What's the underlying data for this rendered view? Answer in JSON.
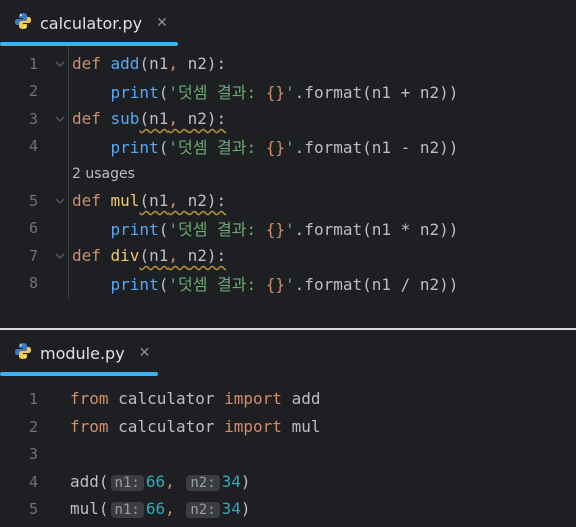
{
  "pane1": {
    "tab": {
      "title": "calculator.py",
      "close": "✕",
      "icon": "python-icon"
    },
    "lines": [
      {
        "num": "1",
        "tokens": [
          [
            "kw",
            "def "
          ],
          [
            "fn-def",
            "add"
          ],
          [
            "",
            "(n1"
          ],
          [
            "kw",
            ", "
          ],
          [
            "",
            "n2):"
          ]
        ]
      },
      {
        "num": "2",
        "tokens": [
          [
            "",
            "    "
          ],
          [
            "fn",
            "print"
          ],
          [
            "",
            "("
          ],
          [
            "str",
            "'덧셈 결과: "
          ],
          [
            "brace",
            "{}"
          ],
          [
            "str",
            "'"
          ],
          [
            "",
            ".format(n1 + n2))"
          ]
        ]
      },
      {
        "num": "3",
        "tokens": [
          [
            "kw",
            "def "
          ],
          [
            "fn-def",
            "sub"
          ],
          [
            "",
            "(n1"
          ],
          [
            "kw",
            ", "
          ],
          [
            "",
            "n2):"
          ]
        ]
      },
      {
        "num": "4",
        "tokens": [
          [
            "",
            "    "
          ],
          [
            "fn",
            "print"
          ],
          [
            "",
            "("
          ],
          [
            "str",
            "'덧셈 결과: "
          ],
          [
            "brace",
            "{}"
          ],
          [
            "str",
            "'"
          ],
          [
            "",
            ".format(n1 - n2))"
          ]
        ]
      },
      {
        "num": "5",
        "tokens": [
          [
            "kw",
            "def "
          ],
          [
            "fn-yellow",
            "mul"
          ],
          [
            "",
            "(n1"
          ],
          [
            "kw",
            ", "
          ],
          [
            "",
            "n2):"
          ]
        ]
      },
      {
        "num": "6",
        "tokens": [
          [
            "",
            "    "
          ],
          [
            "fn",
            "print"
          ],
          [
            "",
            "("
          ],
          [
            "str",
            "'덧셈 결과: "
          ],
          [
            "brace",
            "{}"
          ],
          [
            "str",
            "'"
          ],
          [
            "",
            ".format(n1 * n2))"
          ]
        ]
      },
      {
        "num": "7",
        "tokens": [
          [
            "kw",
            "def "
          ],
          [
            "fn-yellow",
            "div"
          ],
          [
            "",
            "(n1"
          ],
          [
            "kw",
            ", "
          ],
          [
            "",
            "n2):"
          ]
        ]
      },
      {
        "num": "8",
        "tokens": [
          [
            "",
            "    "
          ],
          [
            "fn",
            "print"
          ],
          [
            "",
            "("
          ],
          [
            "str",
            "'덧셈 결과: "
          ],
          [
            "brace",
            "{}"
          ],
          [
            "str",
            "'"
          ],
          [
            "",
            ".format(n1 / n2))"
          ]
        ]
      }
    ],
    "usages": "2 usages"
  },
  "pane2": {
    "tab": {
      "title": "module.py",
      "close": "✕",
      "icon": "python-icon"
    },
    "lines": [
      {
        "num": "1",
        "tokens": [
          [
            "kw",
            "from "
          ],
          [
            "",
            "calculator "
          ],
          [
            "kw",
            "import "
          ],
          [
            "",
            "add"
          ]
        ]
      },
      {
        "num": "2",
        "tokens": [
          [
            "kw",
            "from "
          ],
          [
            "",
            "calculator "
          ],
          [
            "kw",
            "import "
          ],
          [
            "",
            "mul"
          ]
        ]
      },
      {
        "num": "3",
        "tokens": []
      },
      {
        "num": "4",
        "tokens": [
          [
            "",
            "add("
          ],
          [
            "hint",
            "n1:"
          ],
          [
            "num",
            "66"
          ],
          [
            "kw",
            ", "
          ],
          [
            "hint",
            "n2:"
          ],
          [
            "num",
            "34"
          ],
          [
            "",
            ")"
          ]
        ]
      },
      {
        "num": "5",
        "tokens": [
          [
            "",
            "mul("
          ],
          [
            "hint",
            "n1:"
          ],
          [
            "num",
            "66"
          ],
          [
            "kw",
            ", "
          ],
          [
            "hint",
            "n2:"
          ],
          [
            "num",
            "34"
          ],
          [
            "",
            ")"
          ]
        ]
      }
    ]
  },
  "colors": {
    "accent": "#3ab1f0",
    "keyword": "#cf8e6d",
    "function": "#56a8f5",
    "string": "#6aab73",
    "number": "#2aacb8",
    "background": "#1e1f22"
  }
}
